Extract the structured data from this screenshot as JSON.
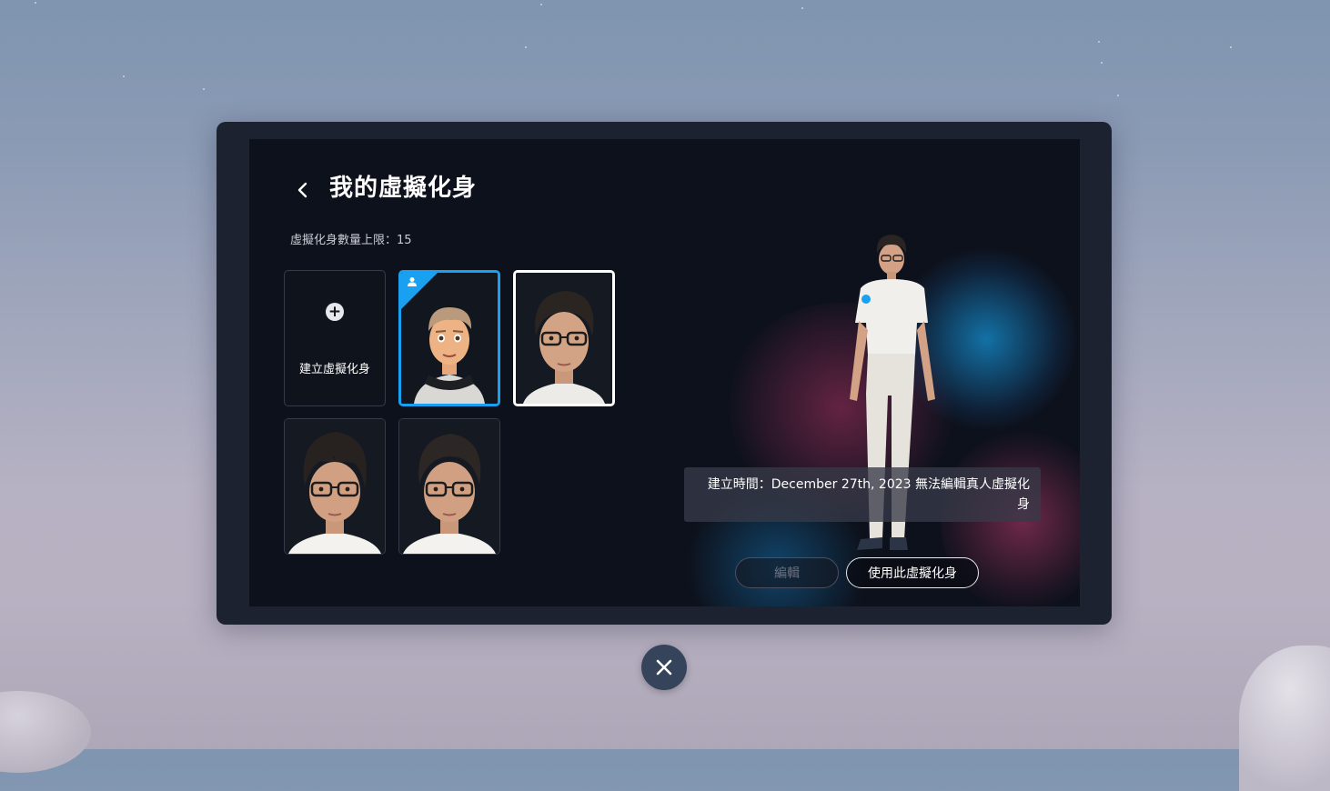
{
  "header": {
    "back_icon": "chevron-left-icon",
    "title": "我的虛擬化身"
  },
  "limit_text": "虛擬化身數量上限：15",
  "create_tile": {
    "icon": "plus-circle-icon",
    "label": "建立虛擬化身"
  },
  "avatars": [
    {
      "name": "cartoon-avatar",
      "state": "active",
      "badge_icon": "person-icon"
    },
    {
      "name": "realistic-avatar-1",
      "state": "selected"
    },
    {
      "name": "realistic-avatar-2",
      "state": "normal"
    },
    {
      "name": "realistic-avatar-3",
      "state": "normal"
    }
  ],
  "info": {
    "text": "建立時間：December 27th, 2023 無法編輯真人虛擬化身"
  },
  "buttons": {
    "edit_label": "編輯",
    "use_label": "使用此虛擬化身"
  },
  "close_icon": "close-icon",
  "colors": {
    "accent": "#1aa0f0",
    "panel_bg": "#0d111b",
    "close_bg": "#35445b"
  }
}
